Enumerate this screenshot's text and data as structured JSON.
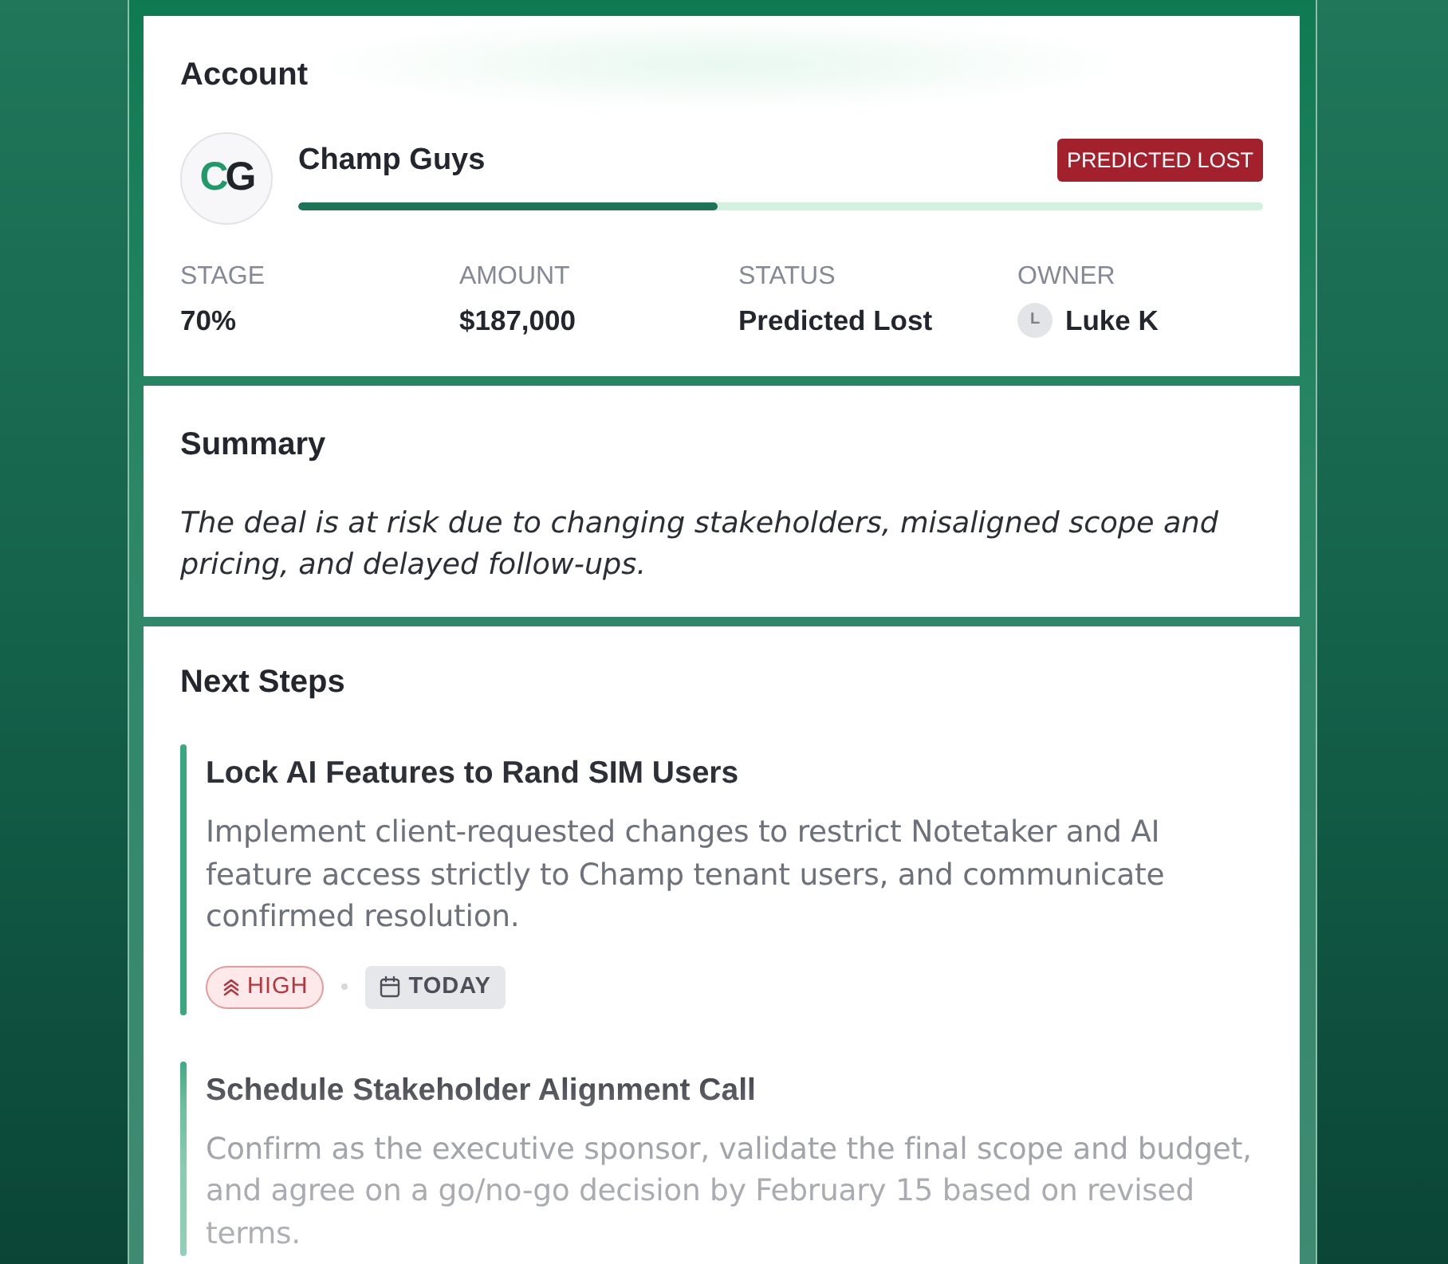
{
  "account": {
    "heading": "Account",
    "logo": "CG",
    "name": "Champ Guys",
    "badge": {
      "label": "PREDICTED LOST",
      "kind": "danger"
    },
    "progress": {
      "level": 0.435
    },
    "stats": [
      {
        "label": "STAGE",
        "value": "70%"
      },
      {
        "label": "AMOUNT",
        "value": "$187,000"
      },
      {
        "label": "STATUS",
        "value": "Predicted Lost"
      },
      {
        "label": "OWNER",
        "value": "Luke K",
        "avatar": "L"
      }
    ]
  },
  "summary": {
    "heading": "Summary",
    "text": "The deal is at risk due to changing stakeholders, misaligned scope and pricing, and delayed follow-ups."
  },
  "next_steps": {
    "heading": "Next Steps",
    "items": [
      {
        "title": "Lock AI Features to Rand SIM Users",
        "description": "Implement client-requested changes to restrict Notetaker and AI feature access strictly to Champ tenant users, and communicate confirmed resolution.",
        "tags": [
          {
            "kind": "priority",
            "label": "HIGH"
          },
          {
            "kind": "due",
            "label": "TODAY"
          }
        ]
      },
      {
        "title": "Schedule Stakeholder Alignment Call",
        "description": "Confirm as the executive sponsor, validate the final scope and budget, and agree on a go/no-go decision by February 15 based on revised terms."
      }
    ]
  }
}
